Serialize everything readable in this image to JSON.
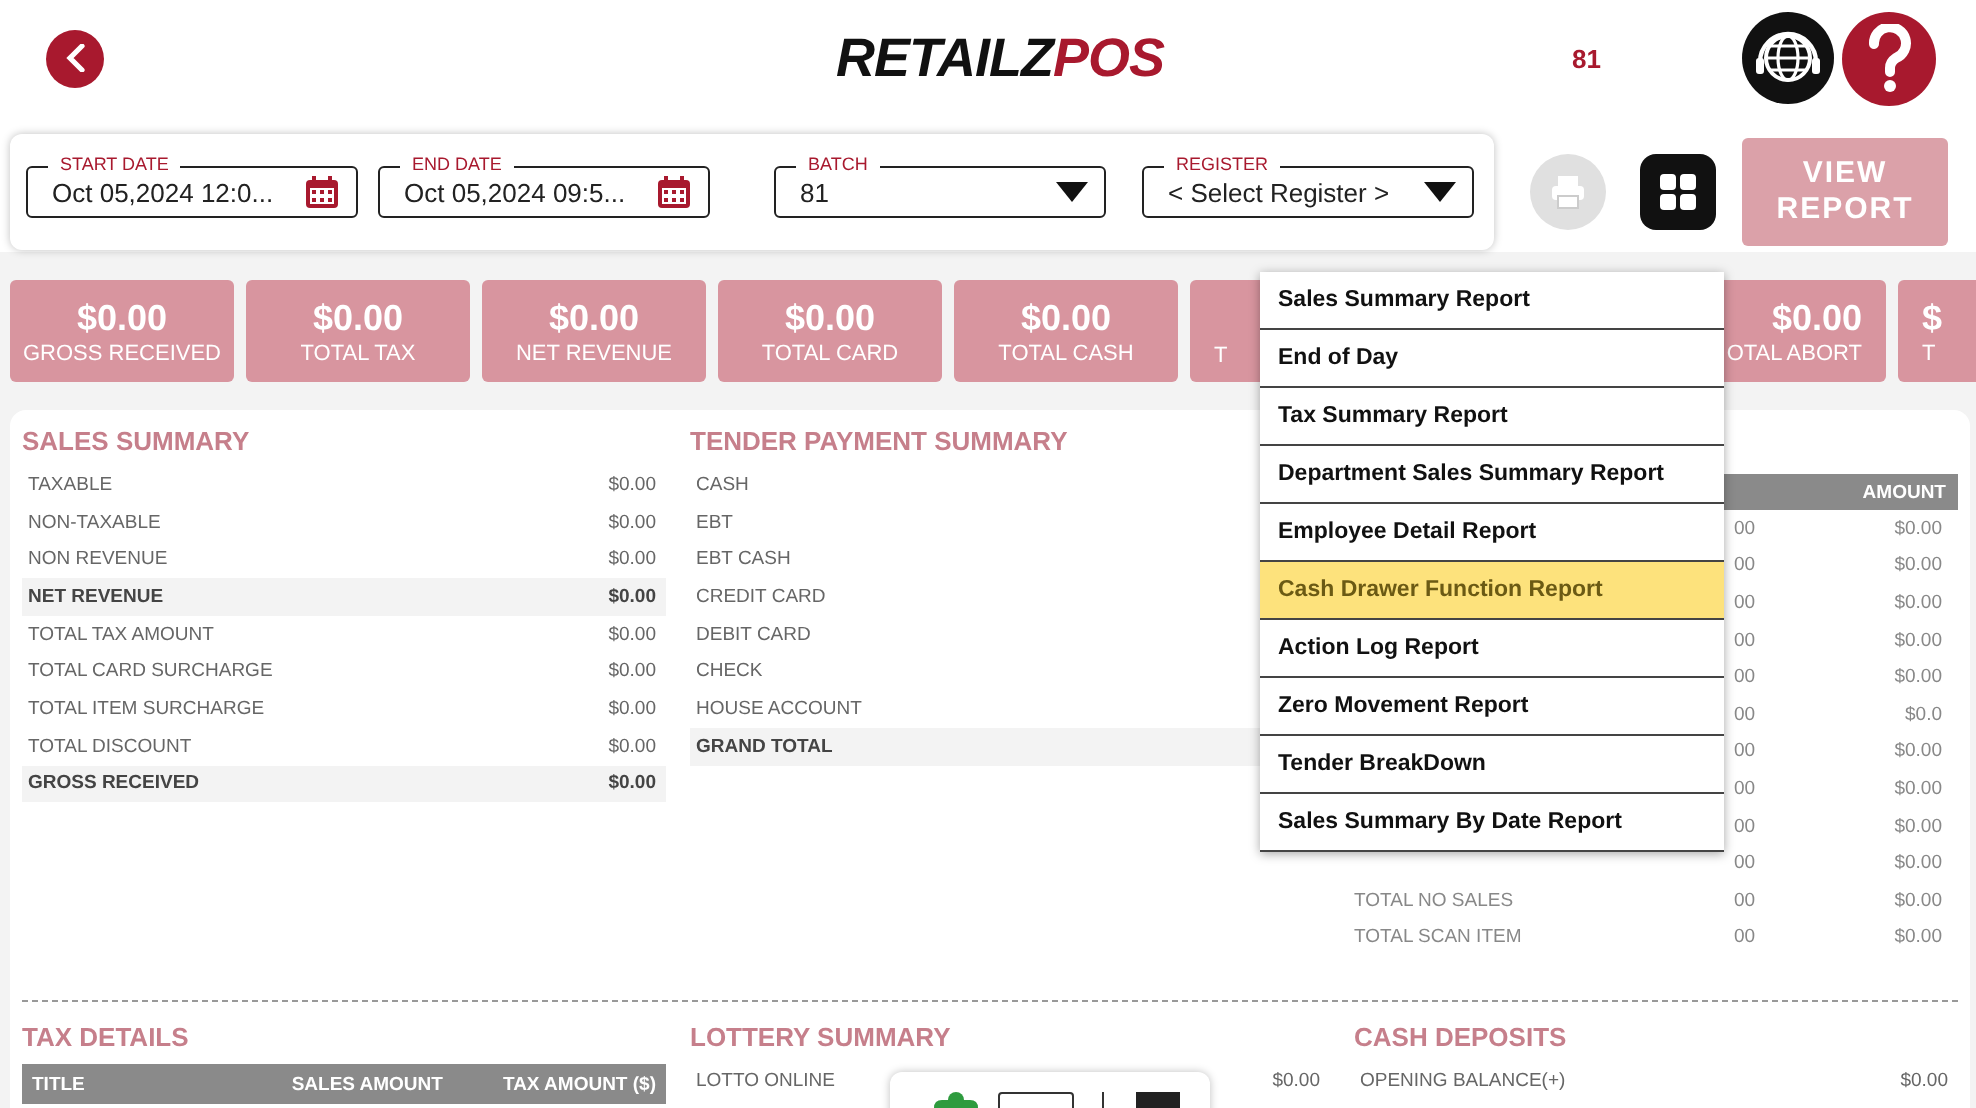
{
  "header": {
    "logo": {
      "part1": "RETAILZ",
      "part2": "POS"
    },
    "batch_number": "81"
  },
  "filters": [
    {
      "kind": "date",
      "label": "START DATE",
      "value": "Oct 05,2024 12:0..."
    },
    {
      "kind": "date",
      "label": "END DATE",
      "value": "Oct 05,2024 09:5..."
    },
    {
      "kind": "select",
      "label": "BATCH",
      "value": "81"
    },
    {
      "kind": "select",
      "label": "REGISTER",
      "value": "< Select Register >"
    }
  ],
  "view_report_button": {
    "label": "VIEW\nREPORT",
    "disabled": true
  },
  "print_button": {
    "disabled": true
  },
  "tiles": [
    {
      "amount": "$0.00",
      "label": "GROSS RECEIVED"
    },
    {
      "amount": "$0.00",
      "label": "TOTAL TAX"
    },
    {
      "amount": "$0.00",
      "label": "NET REVENUE"
    },
    {
      "amount": "$0.00",
      "label": "TOTAL CARD"
    },
    {
      "amount": "$0.00",
      "label": "TOTAL CASH"
    },
    {
      "label": "T"
    },
    {
      "amount": "$0.00",
      "label": "OTAL ABORT"
    },
    {
      "amount": "$",
      "label": "T"
    }
  ],
  "sales_summary": {
    "title": "SALES SUMMARY",
    "rows": [
      {
        "label": "TAXABLE",
        "value": "$0.00",
        "highlight": false
      },
      {
        "label": "NON-TAXABLE",
        "value": "$0.00",
        "highlight": false
      },
      {
        "label": "NON REVENUE",
        "value": "$0.00",
        "highlight": false
      },
      {
        "label": "NET REVENUE",
        "value": "$0.00",
        "highlight": true
      },
      {
        "label": "TOTAL TAX AMOUNT",
        "value": "$0.00",
        "highlight": false
      },
      {
        "label": "TOTAL CARD SURCHARGE",
        "value": "$0.00",
        "highlight": false
      },
      {
        "label": "TOTAL ITEM SURCHARGE",
        "value": "$0.00",
        "highlight": false
      },
      {
        "label": "TOTAL DISCOUNT",
        "value": "$0.00",
        "highlight": false
      },
      {
        "label": "GROSS RECEIVED",
        "value": "$0.00",
        "highlight": true
      }
    ]
  },
  "tender_payment_summary": {
    "title": "TENDER PAYMENT SUMMARY",
    "rows": [
      {
        "label": "CASH",
        "highlight": false
      },
      {
        "label": "EBT",
        "highlight": false
      },
      {
        "label": "EBT CASH",
        "highlight": false
      },
      {
        "label": "CREDIT CARD",
        "highlight": false
      },
      {
        "label": "DEBIT CARD",
        "highlight": false
      },
      {
        "label": "CHECK",
        "highlight": false
      },
      {
        "label": "HOUSE ACCOUNT",
        "highlight": false
      },
      {
        "label": "GRAND TOTAL",
        "highlight": true
      }
    ]
  },
  "column_3": {
    "columns": [
      "AMOUNT"
    ],
    "rows": [
      {
        "count": "00",
        "amount": "$0.00"
      },
      {
        "count": "00",
        "amount": "$0.00"
      },
      {
        "count": "00",
        "amount": "$0.00"
      },
      {
        "count": "00",
        "amount": "$0.00"
      },
      {
        "count": "00",
        "amount": "$0.00"
      },
      {
        "count": "00",
        "amount": "$0.0"
      },
      {
        "count": "00",
        "amount": "$0.00"
      },
      {
        "count": "00",
        "amount": "$0.00"
      },
      {
        "count": "00",
        "amount": "$0.00"
      },
      {
        "count": "00",
        "amount": "$0.00"
      },
      {
        "label": "TOTAL NO SALES",
        "count": "00",
        "amount": "$0.00"
      },
      {
        "label": "TOTAL SCAN ITEM",
        "count": "00",
        "amount": "$0.00"
      }
    ]
  },
  "report_menu": [
    {
      "label": "Sales Summary Report",
      "selected": false
    },
    {
      "label": "End of Day",
      "selected": false
    },
    {
      "label": "Tax Summary Report",
      "selected": false
    },
    {
      "label": "Department Sales Summary Report",
      "selected": false
    },
    {
      "label": "Employee Detail Report",
      "selected": false
    },
    {
      "label": "Cash Drawer Function Report",
      "selected": true
    },
    {
      "label": "Action Log Report",
      "selected": false
    },
    {
      "label": "Zero Movement Report",
      "selected": false
    },
    {
      "label": "Tender BreakDown",
      "selected": false
    },
    {
      "label": "Sales Summary By Date Report",
      "selected": false
    }
  ],
  "tax_details": {
    "title": "TAX DETAILS",
    "columns": [
      "TITLE",
      "SALES AMOUNT",
      "TAX AMOUNT ($)"
    ]
  },
  "lottery_summary": {
    "title": "LOTTERY SUMMARY",
    "rows": [
      {
        "label": "LOTTO ONLINE",
        "value": "$0.00"
      }
    ]
  },
  "cash_deposits": {
    "title": "CASH DEPOSITS",
    "rows": [
      {
        "label": "OPENING BALANCE(+)",
        "value": "$0.00"
      }
    ]
  }
}
